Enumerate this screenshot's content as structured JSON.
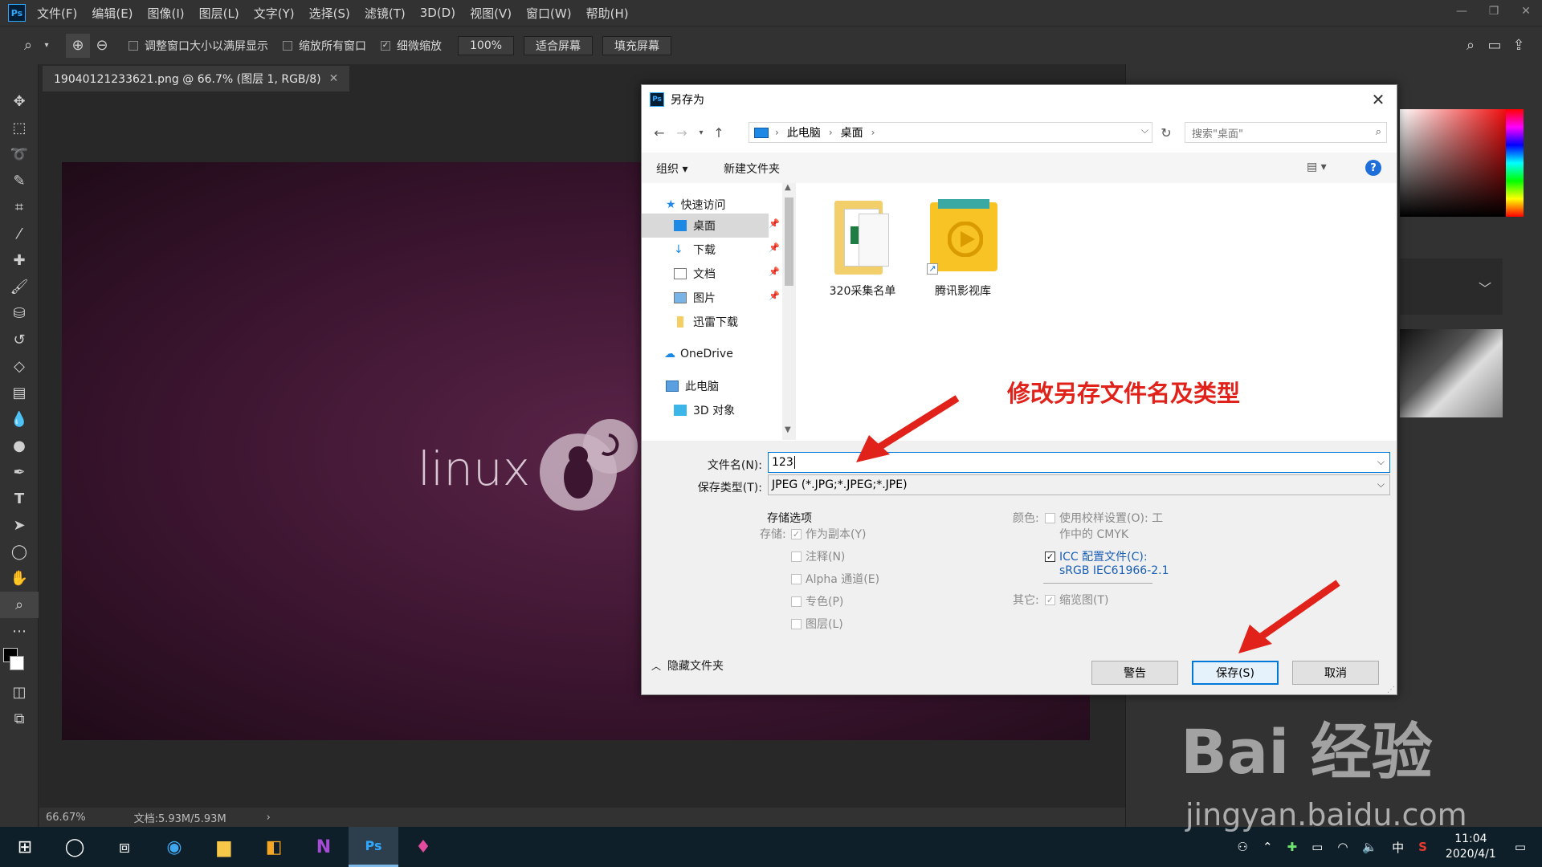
{
  "app": {
    "logo": "Ps",
    "menu": [
      "文件(F)",
      "编辑(E)",
      "图像(I)",
      "图层(L)",
      "文字(Y)",
      "选择(S)",
      "滤镜(T)",
      "3D(D)",
      "视图(V)",
      "窗口(W)",
      "帮助(H)"
    ]
  },
  "optionsbar": {
    "resize_windows": "调整窗口大小以满屏显示",
    "zoom_all": "缩放所有窗口",
    "scrubby_zoom": "细微缩放",
    "zoom_value": "100%",
    "fit_screen": "适合屏幕",
    "fill_screen": "填充屏幕"
  },
  "document": {
    "tab_title": "19040121233621.png @ 66.7% (图层 1, RGB/8)",
    "canvas_text": "linux",
    "zoom": "66.67%",
    "doc_size": "文档:5.93M/5.93M"
  },
  "dialog": {
    "title": "另存为",
    "breadcrumb": [
      "此电脑",
      "桌面"
    ],
    "search_placeholder": "搜索\"桌面\"",
    "organize": "组织 ▾",
    "new_folder": "新建文件夹",
    "nav": {
      "quick_access": "快速访问",
      "desktop": "桌面",
      "downloads": "下载",
      "documents": "文档",
      "pictures": "图片",
      "thunder": "迅雷下载",
      "onedrive": "OneDrive",
      "this_pc": "此电脑",
      "objects3d": "3D 对象"
    },
    "files": [
      "320采集名单",
      "腾讯影视库"
    ],
    "annotation": "修改另存文件名及类型",
    "filename_label": "文件名(N):",
    "filename_value": "123",
    "filetype_label": "保存类型(T):",
    "filetype_value": "JPEG (*.JPG;*.JPEG;*.JPE)",
    "save_options_title": "存储选项",
    "save_label": "存储:",
    "as_copy": "作为副本(Y)",
    "notes": "注释(N)",
    "alpha": "Alpha 通道(E)",
    "spot": "专色(P)",
    "layers": "图层(L)",
    "color_label": "颜色:",
    "proof_setup_1": "使用校样设置(O): 工",
    "proof_setup_2": "作中的 CMYK",
    "icc_1": "ICC 配置文件(C):",
    "icc_2": "sRGB IEC61966-2.1",
    "other_label": "其它:",
    "thumbnail": "缩览图(T)",
    "hide_folders": "隐藏文件夹",
    "warn_btn": "警告",
    "save_btn": "保存(S)",
    "cancel_btn": "取消"
  },
  "taskbar": {
    "ime": "中",
    "time": "11:04",
    "date": "2020/4/1"
  },
  "watermark": {
    "brand": "Bai 经验",
    "url": "jingyan.baidu.com"
  },
  "colors": {
    "accent": "#0078d7",
    "annotation_red": "#e1221b",
    "ps_blue": "#31a8ff"
  }
}
